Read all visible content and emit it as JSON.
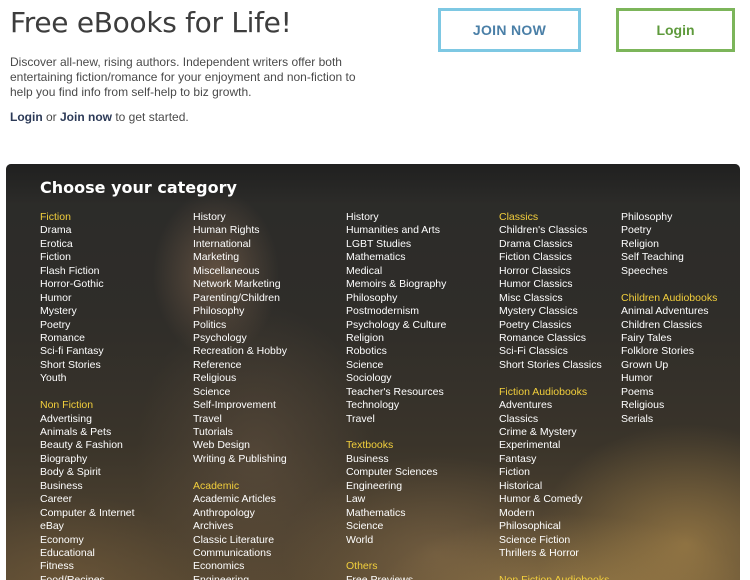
{
  "hero": {
    "title": "Free eBooks for Life!",
    "description": "Discover all-new, rising authors. Independent writers offer both entertaining fiction/romance for your enjoyment and non-fiction to help you find info from self-help to biz growth.",
    "cta_login": "Login",
    "cta_or": " or ",
    "cta_join": "Join now",
    "cta_suffix": " to get started."
  },
  "buttons": {
    "join": "JOIN NOW",
    "login": "Login"
  },
  "panel": {
    "title": "Choose your category"
  },
  "columns": [
    [
      {
        "head": "Fiction"
      },
      "Drama",
      "Erotica",
      "Fiction",
      "Flash Fiction",
      "Horror-Gothic",
      "Humor",
      "Mystery",
      "Poetry",
      "Romance",
      "Sci-fi Fantasy",
      "Short Stories",
      "Youth",
      {
        "gap": true
      },
      {
        "head": "Non Fiction"
      },
      "Advertising",
      "Animals & Pets",
      "Beauty & Fashion",
      "Biography",
      "Body & Spirit",
      "Business",
      "Career",
      "Computer & Internet",
      "eBay",
      "Economy",
      "Educational",
      "Fitness",
      "Food/Recipes"
    ],
    [
      "History",
      "Human Rights",
      "International",
      "Marketing",
      "Miscellaneous",
      "Network Marketing",
      "Parenting/Children",
      "Philosophy",
      "Politics",
      "Psychology",
      "Recreation & Hobby",
      "Reference",
      "Religious",
      "Science",
      "Self-Improvement",
      "Travel",
      "Tutorials",
      "Web Design",
      "Writing & Publishing",
      {
        "gap": true
      },
      {
        "head": "Academic"
      },
      "Academic Articles",
      "Anthropology",
      "Archives",
      "Classic Literature",
      "Communications",
      "Economics",
      "Engineering"
    ],
    [
      "History",
      "Humanities and Arts",
      "LGBT Studies",
      "Mathematics",
      "Medical",
      "Memoirs & Biography",
      "Philosophy",
      "Postmodernism",
      "Psychology & Culture",
      "Religion",
      "Robotics",
      "Science",
      "Sociology",
      "Teacher's Resources",
      "Technology",
      "Travel",
      {
        "gap": true
      },
      {
        "head": "Textbooks"
      },
      "Business",
      "Computer Sciences",
      "Engineering",
      "Law",
      "Mathematics",
      "Science",
      "World",
      {
        "gap": true
      },
      {
        "head": "Others"
      },
      "Free Previews"
    ],
    [
      {
        "head": "Classics"
      },
      "Children's Classics",
      "Drama Classics",
      "Fiction Classics",
      "Horror Classics",
      "Humor Classics",
      "Misc Classics",
      "Mystery Classics",
      "Poetry Classics",
      "Romance Classics",
      "Sci-Fi Classics",
      "Short Stories Classics",
      {
        "gap": true
      },
      {
        "head": "Fiction Audiobooks"
      },
      "Adventures",
      "Classics",
      "Crime & Mystery",
      "Experimental",
      "Fantasy",
      "Fiction",
      "Historical",
      "Humor & Comedy",
      "Modern",
      "Philosophical",
      "Science Fiction",
      "Thrillers & Horror",
      {
        "gap": true
      },
      {
        "head": "Non Fiction Audiobooks"
      }
    ],
    [
      "Philosophy",
      "Poetry",
      "Religion",
      "Self Teaching",
      "Speeches",
      {
        "gap": true
      },
      {
        "head": "Children Audiobooks"
      },
      "Animal Adventures",
      "Children Classics",
      "Fairy Tales",
      "Folklore Stories",
      "Grown Up",
      "Humor",
      "Poems",
      "Religious",
      "Serials"
    ]
  ]
}
